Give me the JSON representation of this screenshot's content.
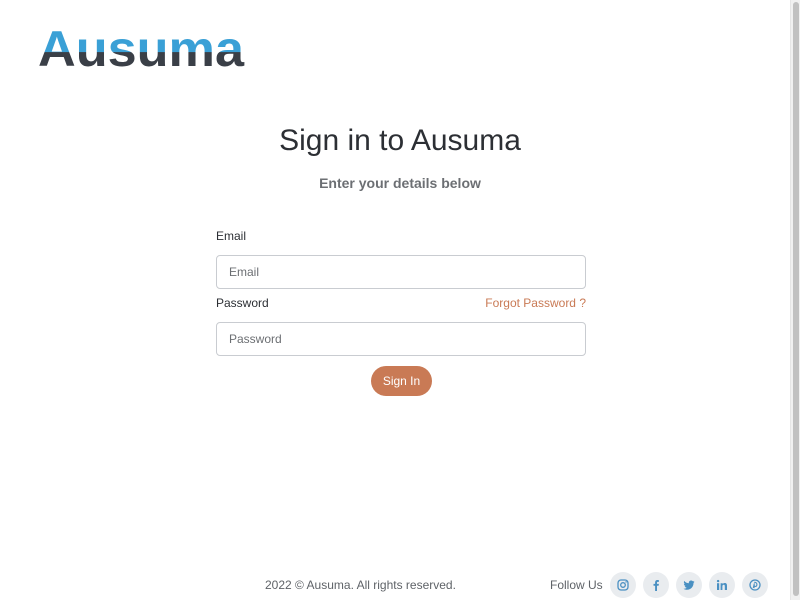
{
  "brand": {
    "logo_text": "Ausuma",
    "colors": {
      "logo_top": "#3aa0d6",
      "logo_bottom": "#3a3f47",
      "accent": "#c97a55",
      "social_icon": "#4a90c2"
    }
  },
  "login": {
    "title": "Sign in to Ausuma",
    "subtitle": "Enter your details below",
    "email_label": "Email",
    "email_placeholder": "Email",
    "email_value": "",
    "password_label": "Password",
    "password_placeholder": "Password",
    "password_value": "",
    "forgot_label": "Forgot Password ?",
    "signin_label": "Sign In"
  },
  "footer": {
    "copyright": "2022 © Ausuma. All rights reserved.",
    "follow_label": "Follow Us",
    "social": [
      "instagram-icon",
      "facebook-icon",
      "twitter-icon",
      "linkedin-icon",
      "pinterest-icon"
    ]
  }
}
